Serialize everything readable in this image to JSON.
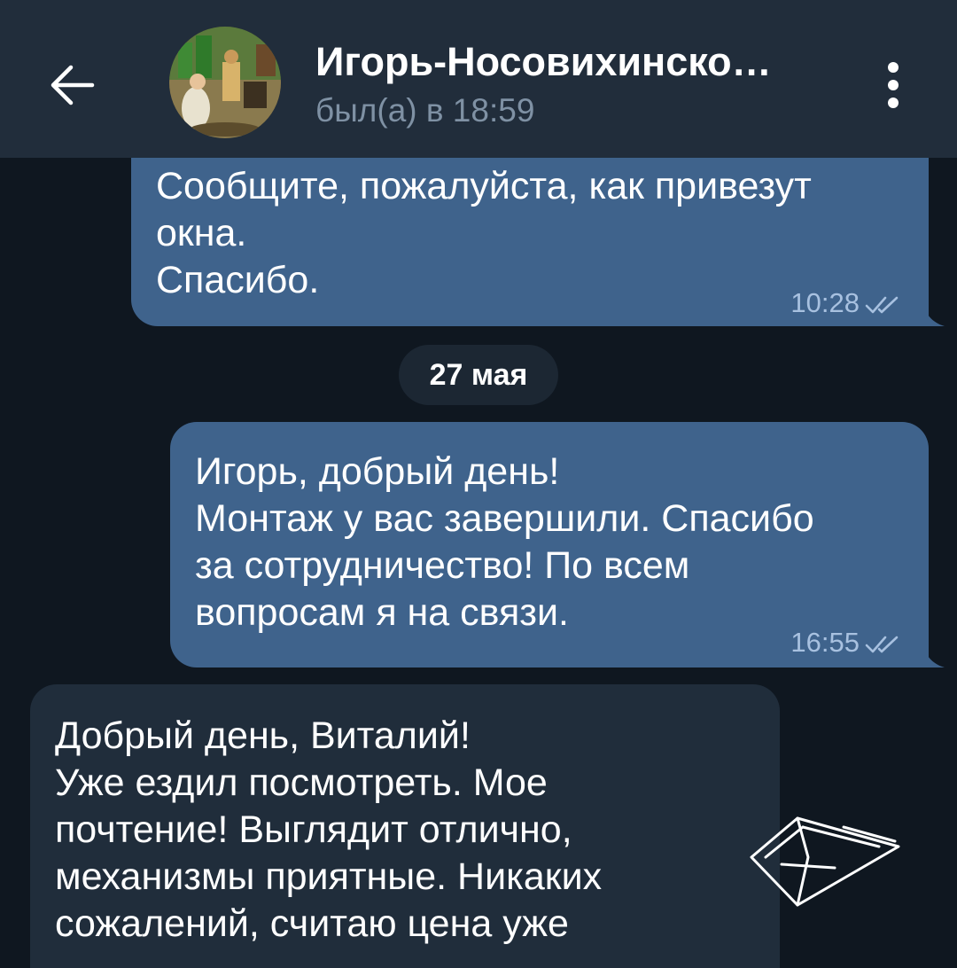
{
  "header": {
    "title": "Игорь-Носовихинско…",
    "status": "был(а) в 18:59",
    "back_icon": "arrow-left-icon",
    "menu_icon": "more-vertical-icon"
  },
  "messages": [
    {
      "direction": "outgoing",
      "text": "Сообщите, пожалуйста, как привезут\nокна.\nСпасибо.",
      "time": "10:28",
      "status_icon": "double-check-icon"
    },
    {
      "direction": "outgoing",
      "text": "Игорь, добрый день!\nМонтаж у вас завершили. Спасибо\nза сотрудничество! По всем\nвопросам я на связи.",
      "time": "16:55",
      "status_icon": "double-check-icon"
    },
    {
      "direction": "incoming",
      "text": "Добрый день, Виталий!\nУже ездил посмотреть. Мое\nпочтение! Выглядит отлично,\nмеханизмы приятные. Никаких\nсожалений, считаю цена уже"
    }
  ],
  "date_separator": "27 мая",
  "colors": {
    "background": "#0f1720",
    "header": "#212d3b",
    "outgoing_bubble": "#3f638c",
    "incoming_bubble": "#202d3b",
    "status_text": "#7f91a4",
    "time_text": "#a8c1e0"
  },
  "watermark_icon": "open-book-logo-icon"
}
